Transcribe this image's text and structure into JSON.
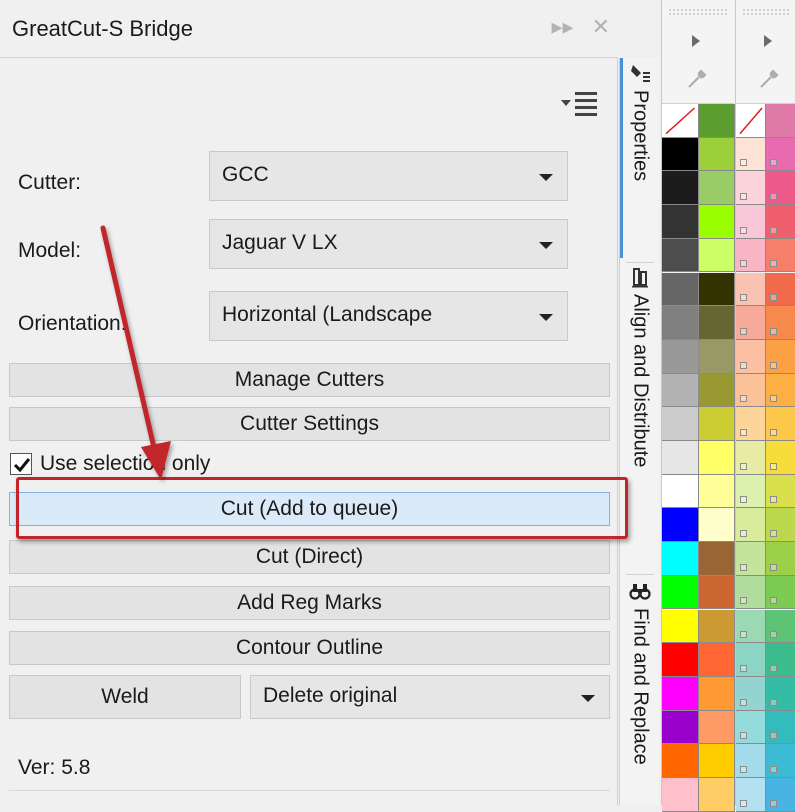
{
  "panel": {
    "title": "GreatCut-S Bridge",
    "title_buttons": [
      "▸▸",
      "✕"
    ],
    "cutter_label": "Cutter:",
    "cutter_value": "GCC",
    "model_label": "Model:",
    "model_value": "Jaguar V LX",
    "orientation_label": "Orientation:",
    "orientation_value": "Horizontal (Landscape",
    "buttons": {
      "manage_cutters": "Manage Cutters",
      "cutter_settings": "Cutter Settings",
      "cut_add_to_queue": "Cut (Add to queue)",
      "cut_direct": "Cut (Direct)",
      "add_reg_marks": "Add Reg Marks",
      "contour_outline": "Contour Outline",
      "weld": "Weld"
    },
    "use_selection_label": "Use selection only",
    "use_selection_checked": true,
    "weld_option_value": "Delete original",
    "version": "Ver: 5.8"
  },
  "side_tabs": [
    {
      "label": "Properties",
      "icon": "properties-icon"
    },
    {
      "label": "Align and Distribute",
      "icon": "align-icon"
    },
    {
      "label": "Find and Replace",
      "icon": "binoculars-icon"
    }
  ],
  "annotation_color": "#c0252b",
  "palette_left": {
    "col1": [
      "none",
      "#000000",
      "#1c1c1c",
      "#333333",
      "#4d4d4d",
      "#666666",
      "#808080",
      "#999999",
      "#b3b3b3",
      "#cccccc",
      "#e6e6e6",
      "#ffffff",
      "#0000ff",
      "#00ffff",
      "#00ff00",
      "#ffff00",
      "#ff0000",
      "#ff00ff",
      "#9900cc",
      "#ff6600",
      "#ffc0cb"
    ],
    "col2": [
      "#5b9e2f",
      "#9bd03b",
      "#99cc66",
      "#99ff00",
      "#ccff66",
      "#333300",
      "#666633",
      "#999966",
      "#999933",
      "#cccc33",
      "#ffff66",
      "#ffff99",
      "#ffffcc",
      "#996633",
      "#cc6633",
      "#cc9933",
      "#ff6633",
      "#ff9933",
      "#ff9966",
      "#ffcc00",
      "#ffcc66"
    ]
  },
  "palette_right": {
    "col1": [
      "none",
      "#fde2d6",
      "#fbd3d8",
      "#f8c8d8",
      "#fbb4c4",
      "#f9c3b4",
      "#f7a99a",
      "#fbbfa4",
      "#fbc29a",
      "#fcd59b",
      "#e7eba4",
      "#dcf0b0",
      "#d8ec9c",
      "#c4e49c",
      "#b0dc9c",
      "#9cd8b4",
      "#8cd4c4",
      "#94d4d0",
      "#94dcdc",
      "#a4dceb",
      "#b4e0f0"
    ],
    "col2": [
      "#e07aa8",
      "#e86ab0",
      "#ef5a8c",
      "#f0606c",
      "#f57f6a",
      "#f26a4c",
      "#f8894c",
      "#fba044",
      "#fcb044",
      "#fcc84a",
      "#f8dc3c",
      "#d9e04c",
      "#bcd84c",
      "#9cd048",
      "#7ccc54",
      "#5cc474",
      "#3cbc8c",
      "#34bca4",
      "#34bcbc",
      "#3cbcd4",
      "#48b4e4"
    ]
  }
}
